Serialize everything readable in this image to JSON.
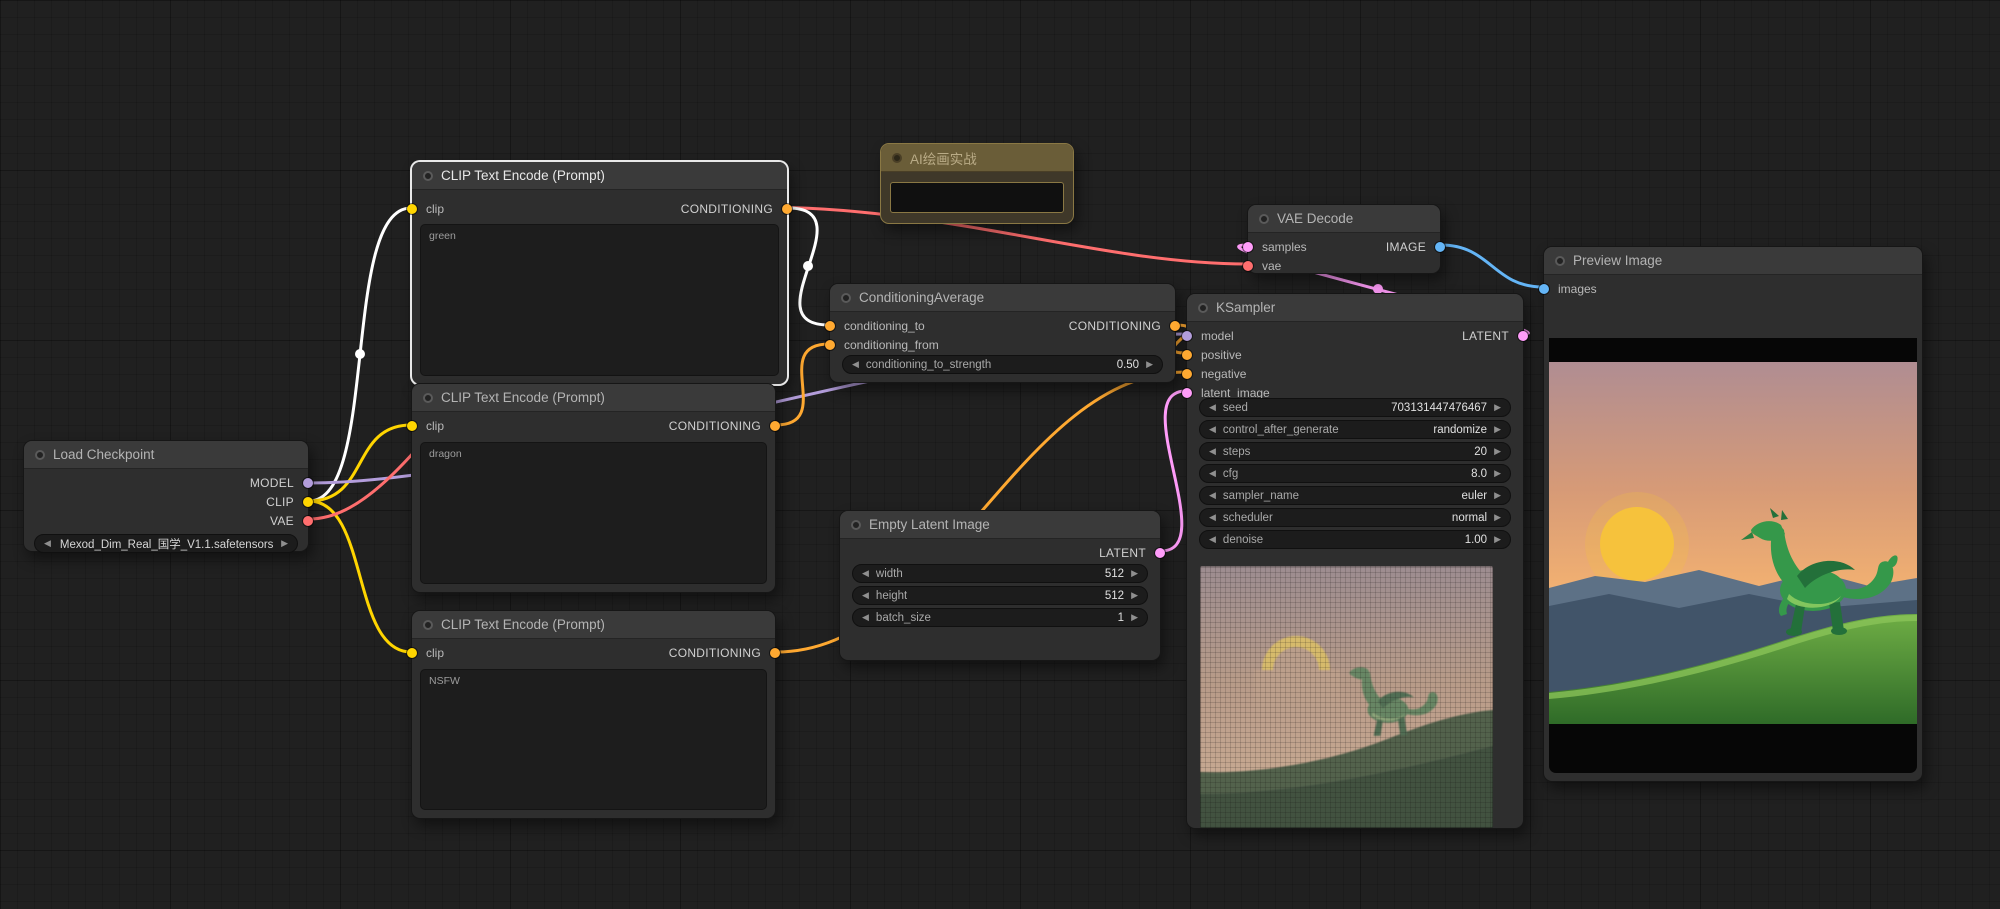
{
  "ui": {
    "arrow_left": "◀",
    "arrow_right": "▶"
  },
  "colors": {
    "model": "#b39ddb",
    "clip": "#ffd500",
    "vae": "#ff6e6e",
    "conditioning": "#ffa931",
    "latent": "#ff9cf9",
    "image": "#64b5f6",
    "selected_wire": "#ffffff"
  },
  "nodes": {
    "load_checkpoint": {
      "title": "Load Checkpoint",
      "outputs": {
        "model": "MODEL",
        "clip": "CLIP",
        "vae": "VAE"
      },
      "ckpt_name": "Mexod_Dim_Real_国学_V1.1.safetensors"
    },
    "clip_encode_green": {
      "title": "CLIP Text Encode (Prompt)",
      "input_clip": "clip",
      "output_conditioning": "CONDITIONING",
      "text": "green"
    },
    "clip_encode_dragon": {
      "title": "CLIP Text Encode (Prompt)",
      "input_clip": "clip",
      "output_conditioning": "CONDITIONING",
      "text": "dragon"
    },
    "clip_encode_nsfw": {
      "title": "CLIP Text Encode (Prompt)",
      "input_clip": "clip",
      "output_conditioning": "CONDITIONING",
      "text": "NSFW"
    },
    "note": {
      "title": "AI绘画实战",
      "text": ""
    },
    "conditioning_average": {
      "title": "ConditioningAverage",
      "input_to": "conditioning_to",
      "input_from": "conditioning_from",
      "output_conditioning": "CONDITIONING",
      "strength": {
        "label": "conditioning_to_strength",
        "value": "0.50"
      }
    },
    "empty_latent": {
      "title": "Empty Latent Image",
      "output_latent": "LATENT",
      "width": {
        "label": "width",
        "value": "512"
      },
      "height": {
        "label": "height",
        "value": "512"
      },
      "batch_size": {
        "label": "batch_size",
        "value": "1"
      }
    },
    "ksampler": {
      "title": "KSampler",
      "inputs": {
        "model": "model",
        "positive": "positive",
        "negative": "negative",
        "latent_image": "latent_image"
      },
      "output_latent": "LATENT",
      "seed": {
        "label": "seed",
        "value": "703131447476467"
      },
      "control_after_generate": {
        "label": "control_after_generate",
        "value": "randomize"
      },
      "steps": {
        "label": "steps",
        "value": "20"
      },
      "cfg": {
        "label": "cfg",
        "value": "8.0"
      },
      "sampler_name": {
        "label": "sampler_name",
        "value": "euler"
      },
      "scheduler": {
        "label": "scheduler",
        "value": "normal"
      },
      "denoise": {
        "label": "denoise",
        "value": "1.00"
      }
    },
    "vae_decode": {
      "title": "VAE Decode",
      "input_samples": "samples",
      "input_vae": "vae",
      "output_image": "IMAGE"
    },
    "preview_image": {
      "title": "Preview Image",
      "input_images": "images"
    }
  }
}
